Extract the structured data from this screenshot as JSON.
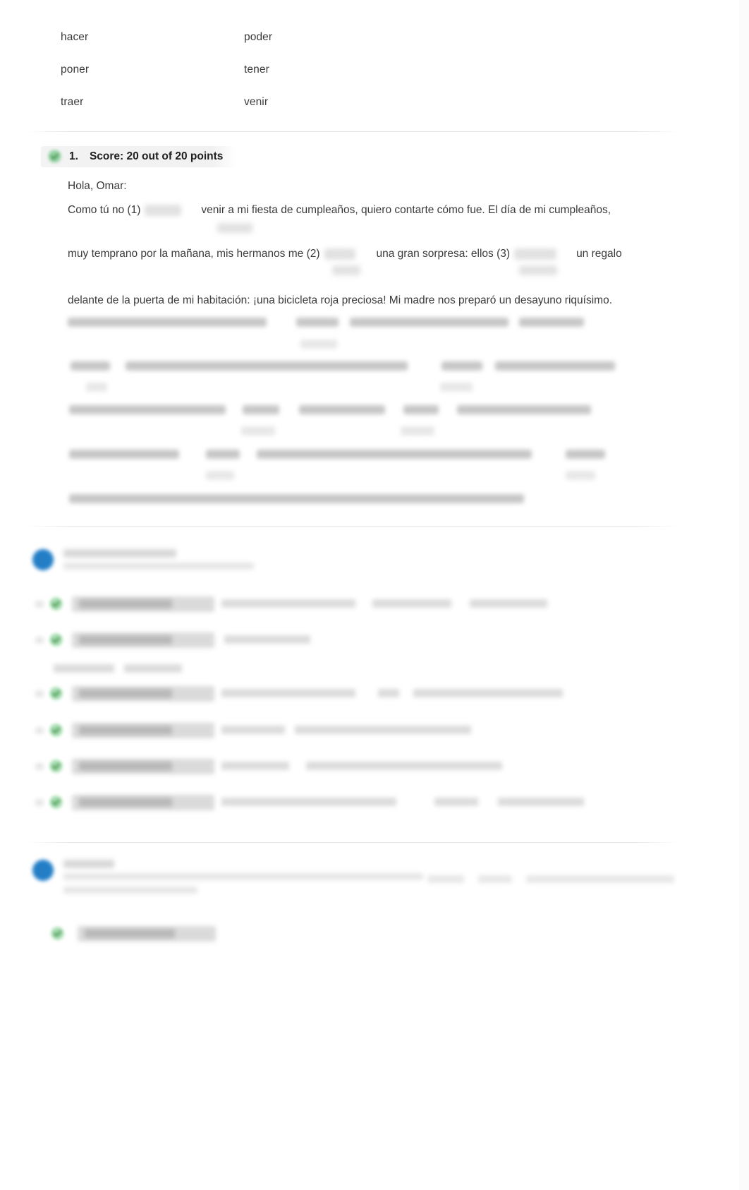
{
  "verbs": {
    "rows": [
      {
        "left": "hacer",
        "right": "poder"
      },
      {
        "left": "poner",
        "right": "tener"
      },
      {
        "left": "traer",
        "right": "venir"
      }
    ]
  },
  "score": {
    "number": "1.",
    "label": "Score: 20 out of 20 points",
    "points_earned": 20,
    "points_total": 20,
    "status_icon": "green-check-icon"
  },
  "passage": {
    "greeting": "Hola, Omar:",
    "line1_before": "Como tú no (1)",
    "line1_after": "venir a mi fiesta de cumpleaños, quiero contarte cómo fue. El día de mi cumpleaños,",
    "line2_before": "muy temprano por la mañana, mis hermanos me (2)",
    "line2_mid": "una gran sorpresa: ellos (3)",
    "line2_after": "un regalo",
    "line3": "delante de la puerta de mi habitación: ¡una bicicleta roja preciosa! Mi madre nos preparó un desayuno riquísimo.",
    "blank_numbers": [
      "(1)",
      "(2)",
      "(3)"
    ]
  },
  "colors": {
    "page_bg": "#ffffff",
    "text": "#3a3a3a",
    "heading": "#1f1f1f",
    "correct_green": "#46a34a",
    "info_blue": "#1878c4",
    "pill_grey": "#d3d3d3",
    "divider": "rgba(0,0,0,0.10)"
  },
  "feedback_top": {
    "icon": "info-circle-icon",
    "rows": [
      {
        "icon": "green-check-icon"
      },
      {
        "icon": "green-check-icon"
      },
      {
        "icon": "green-check-icon"
      },
      {
        "icon": "green-check-icon"
      },
      {
        "icon": "green-check-icon"
      },
      {
        "icon": "green-check-icon"
      }
    ]
  },
  "feedback_bottom": {
    "icon": "info-circle-icon",
    "rows": [
      {
        "icon": "green-check-icon"
      }
    ]
  }
}
